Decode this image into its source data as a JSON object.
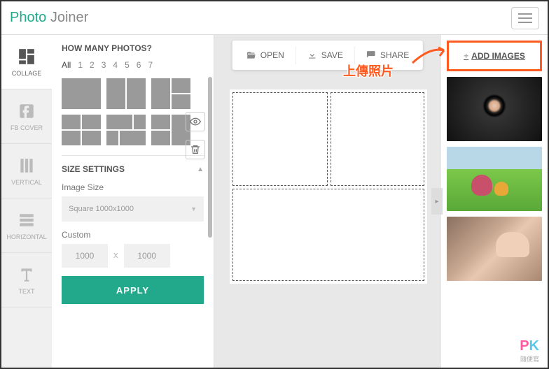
{
  "brand": {
    "part1": "Photo",
    "part2": "Joiner"
  },
  "sidebar": {
    "items": [
      {
        "label": "COLLAGE"
      },
      {
        "label": "FB COVER"
      },
      {
        "label": "VERTICAL"
      },
      {
        "label": "HORIZONTAL"
      },
      {
        "label": "TEXT"
      }
    ]
  },
  "panel": {
    "title": "HOW MANY PHOTOS?",
    "filters": [
      "All",
      "1",
      "2",
      "3",
      "4",
      "5",
      "6",
      "7"
    ],
    "size_settings_title": "SIZE SETTINGS",
    "image_size_label": "Image Size",
    "image_size_value": "Square 1000x1000",
    "custom_label": "Custom",
    "custom_w": "1000",
    "custom_x": "X",
    "custom_h": "1000",
    "apply": "APPLY"
  },
  "toolbar": {
    "open": "OPEN",
    "save": "SAVE",
    "share": "SHARE"
  },
  "right": {
    "add_images": "ADD IMAGES"
  },
  "annotation": {
    "text": "上傳照片"
  },
  "watermark": {
    "a": "P",
    "b": "K",
    "sub": "隨便寫"
  }
}
